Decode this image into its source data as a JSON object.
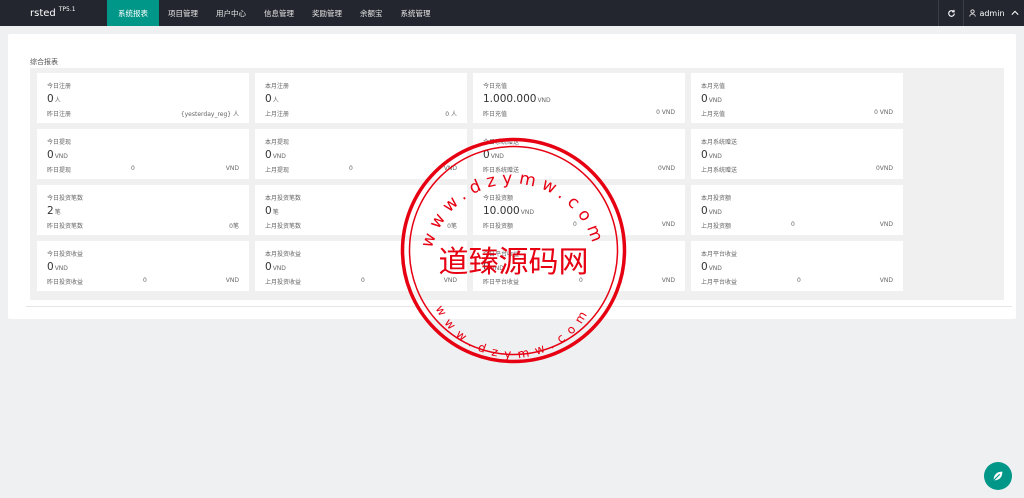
{
  "brand": {
    "name": "rsted",
    "version": "TP5.1"
  },
  "nav": [
    {
      "label": "系统报表",
      "active": true
    },
    {
      "label": "项目管理"
    },
    {
      "label": "用户中心"
    },
    {
      "label": "信息管理"
    },
    {
      "label": "奖励管理"
    },
    {
      "label": "余额宝"
    },
    {
      "label": "系统管理"
    }
  ],
  "topbar": {
    "refresh_icon": "refresh-icon",
    "user_label": "admin",
    "user_chev": "^"
  },
  "section_title": "综合报表",
  "stats": [
    {
      "title": "今日注册",
      "value": "0",
      "unit": "人",
      "foot_label": "昨日注册",
      "foot_mid": "",
      "foot_right": "{yesterday_reg} 人"
    },
    {
      "title": "本月注册",
      "value": "0",
      "unit": "人",
      "foot_label": "上月注册",
      "foot_mid": "",
      "foot_right": "0 人"
    },
    {
      "title": "今日充值",
      "value": "1.000.000",
      "unit": "VND",
      "foot_label": "昨日充值",
      "foot_mid": "",
      "foot_right": "0 VND"
    },
    {
      "title": "本月充值",
      "value": "0",
      "unit": "VND",
      "foot_label": "上月充值",
      "foot_mid": "",
      "foot_right": "0 VND"
    },
    {
      "title": "今日提现",
      "value": "0",
      "unit": "VND",
      "foot_label": "昨日提现",
      "foot_mid": "0",
      "foot_right": "VND"
    },
    {
      "title": "本月提现",
      "value": "0",
      "unit": "VND",
      "foot_label": "上月提现",
      "foot_mid": "0",
      "foot_right": "VND"
    },
    {
      "title": "今日系统赠送",
      "value": "0",
      "unit": "VND",
      "foot_label": "昨日系统赠送",
      "foot_mid": "",
      "foot_right": "0VND"
    },
    {
      "title": "本月系统赠送",
      "value": "0",
      "unit": "VND",
      "foot_label": "上月系统赠送",
      "foot_mid": "",
      "foot_right": "0VND"
    },
    {
      "title": "今日投资笔数",
      "value": "2",
      "unit": "笔",
      "foot_label": "昨日投资笔数",
      "foot_mid": "",
      "foot_right": "0笔"
    },
    {
      "title": "本月投资笔数",
      "value": "0",
      "unit": "笔",
      "foot_label": "上月投资笔数",
      "foot_mid": "",
      "foot_right": "0笔"
    },
    {
      "title": "今日投资额",
      "value": "10.000",
      "unit": "VND",
      "foot_label": "昨日投资额",
      "foot_mid": "0",
      "foot_right": "VND"
    },
    {
      "title": "本月投资额",
      "value": "0",
      "unit": "VND",
      "foot_label": "上月投资额",
      "foot_mid": "0",
      "foot_right": "VND"
    },
    {
      "title": "今日投资收益",
      "value": "0",
      "unit": "VND",
      "foot_label": "昨日投资收益",
      "foot_mid": "0",
      "foot_right": "VND"
    },
    {
      "title": "本月投资收益",
      "value": "0",
      "unit": "VND",
      "foot_label": "上月投资收益",
      "foot_mid": "0",
      "foot_right": "VND"
    },
    {
      "title": "今日平台收益",
      "value": "0",
      "unit": "VND",
      "foot_label": "昨日平台收益",
      "foot_mid": "0",
      "foot_right": "VND"
    },
    {
      "title": "本月平台收益",
      "value": "0",
      "unit": "VND",
      "foot_label": "上月平台收益",
      "foot_mid": "0",
      "foot_right": "VND"
    }
  ],
  "watermark": {
    "center_text": "道臻源码网",
    "top_text": "www.dzymw.com",
    "bottom_text": "www.dzymw.com",
    "color": "#e60012"
  },
  "help_icon": "leaf-help-icon",
  "colors": {
    "topbar": "#23262e",
    "accent": "#009688"
  }
}
